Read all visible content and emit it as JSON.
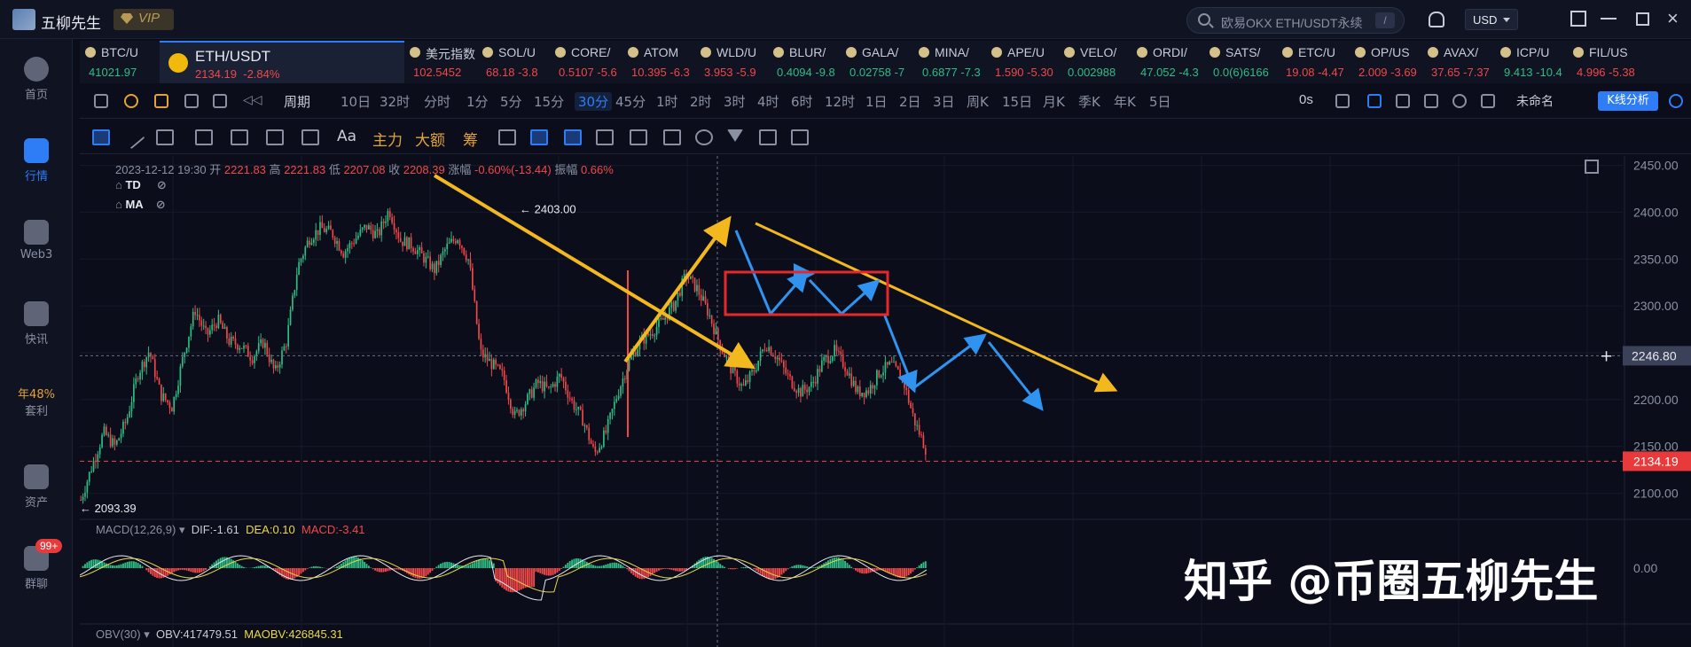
{
  "app": {
    "title": "五柳先生",
    "vip": "VIP"
  },
  "search": {
    "placeholder": "欧易OKX ETH/USDT永续",
    "shortcut": "/"
  },
  "currency": "USD",
  "sidebar": {
    "items": [
      {
        "label": "首页",
        "icon": "home-icon"
      },
      {
        "label": "行情",
        "icon": "market-icon",
        "active": true
      },
      {
        "label": "Web3",
        "icon": "web3-icon"
      },
      {
        "label": "快讯",
        "icon": "news-icon"
      },
      {
        "label": "套利",
        "icon": "arbitrage-icon",
        "pct": "年48%"
      },
      {
        "label": "资产",
        "icon": "wallet-icon"
      },
      {
        "label": "群聊",
        "icon": "chat-icon",
        "badge": "99+"
      }
    ]
  },
  "tickers": [
    {
      "name": "BTC/U",
      "price": "41021.97",
      "dir": "up"
    },
    {
      "name": "美元指数",
      "price": "102.5452",
      "dir": "down"
    },
    {
      "name": "SOL/U",
      "price": "68.18 -3.8",
      "dir": "down"
    },
    {
      "name": "CORE/",
      "price": "0.5107 -5.6",
      "dir": "down"
    },
    {
      "name": "ATOM",
      "price": "10.395 -6.3",
      "dir": "down"
    },
    {
      "name": "WLD/U",
      "price": "3.953 -5.9",
      "dir": "down"
    },
    {
      "name": "BLUR/",
      "price": "0.4094 -9.8",
      "dir": "up"
    },
    {
      "name": "GALA/",
      "price": "0.02758 -7",
      "dir": "up"
    },
    {
      "name": "MINA/",
      "price": "0.6877 -7.3",
      "dir": "up"
    },
    {
      "name": "APE/U",
      "price": "1.590 -5.30",
      "dir": "down"
    },
    {
      "name": "VELO/",
      "price": "0.002988",
      "dir": "up"
    },
    {
      "name": "ORDI/",
      "price": "47.052 -4.3",
      "dir": "up"
    },
    {
      "name": "SATS/",
      "price": "0.0(6)6166",
      "dir": "up"
    },
    {
      "name": "ETC/U",
      "price": "19.08 -4.47",
      "dir": "down"
    },
    {
      "name": "OP/US",
      "price": "2.009 -3.69",
      "dir": "down"
    },
    {
      "name": "AVAX/",
      "price": "37.65 -7.37",
      "dir": "down"
    },
    {
      "name": "ICP/U",
      "price": "9.413 -10.4",
      "dir": "up"
    },
    {
      "name": "FIL/US",
      "price": "4.996 -5.38",
      "dir": "down"
    }
  ],
  "active_ticker": {
    "name": "ETH/USDT",
    "price": "2134.19",
    "change": "-2.84%"
  },
  "periodbar": {
    "label": "周期",
    "periods": [
      "10日",
      "32时",
      "分时",
      "1分",
      "5分",
      "15分",
      "30分",
      "45分",
      "1时",
      "2时",
      "3时",
      "4时",
      "6时",
      "12时",
      "1日",
      "2日",
      "3日",
      "周K",
      "15日",
      "月K",
      "季K",
      "年K",
      "5日"
    ],
    "active": "30分",
    "seconds": "0s",
    "unnamed": "未命名",
    "kline_btn": "K线分析"
  },
  "drawbar": {
    "t1": "Aa",
    "t2": "主力",
    "t3": "大额",
    "t4": "筹"
  },
  "ohlc": {
    "date": "2023-12-12 19:30",
    "open_lbl": "开",
    "open": "2221.83",
    "high_lbl": "高",
    "high": "2221.83",
    "low_lbl": "低",
    "low": "2207.08",
    "close_lbl": "收",
    "close": "2208.39",
    "chg_lbl": "涨幅",
    "chg": "-0.60%(-13.44)",
    "amp_lbl": "振幅",
    "amp": "0.66%"
  },
  "indicators": {
    "td": "TD",
    "ma": "MA"
  },
  "macd": {
    "name": "MACD(12,26,9)",
    "dif": "DIF:-1.61",
    "dea": "DEA:0.10",
    "macd": "MACD:-3.41"
  },
  "obv": {
    "name": "OBV(30)",
    "obv": "OBV:417479.51",
    "maobv": "MAOBV:426845.31"
  },
  "watermark": "知乎 @币圈五柳先生",
  "chart_data": {
    "type": "candlestick",
    "symbol": "ETH/USDT",
    "interval": "30分",
    "price_axis": [
      "2450.00",
      "2400.00",
      "2350.00",
      "2300.00",
      "2250.00",
      "2200.00",
      "2150.00",
      "2100.00"
    ],
    "ylim": [
      2075,
      2460
    ],
    "crosshair_price": "2246.80",
    "last_price": "2134.19",
    "high_marker": "2403.00",
    "low_marker": "2093.39",
    "macd_axis": "0.00",
    "price_path": [
      2093,
      2130,
      2165,
      2150,
      2178,
      2228,
      2252,
      2205,
      2192,
      2248,
      2296,
      2268,
      2285,
      2262,
      2258,
      2245,
      2262,
      2228,
      2262,
      2342,
      2372,
      2383,
      2378,
      2357,
      2371,
      2385,
      2375,
      2403,
      2370,
      2365,
      2352,
      2338,
      2362,
      2374,
      2348,
      2250,
      2238,
      2225,
      2182,
      2198,
      2218,
      2210,
      2226,
      2198,
      2178,
      2142,
      2165,
      2206,
      2240,
      2262,
      2272,
      2285,
      2302,
      2333,
      2318,
      2292,
      2258,
      2232,
      2212,
      2232,
      2260,
      2245,
      2223,
      2208,
      2215,
      2240,
      2252,
      2235,
      2208,
      2210,
      2230,
      2237,
      2222,
      2178,
      2148
    ]
  }
}
